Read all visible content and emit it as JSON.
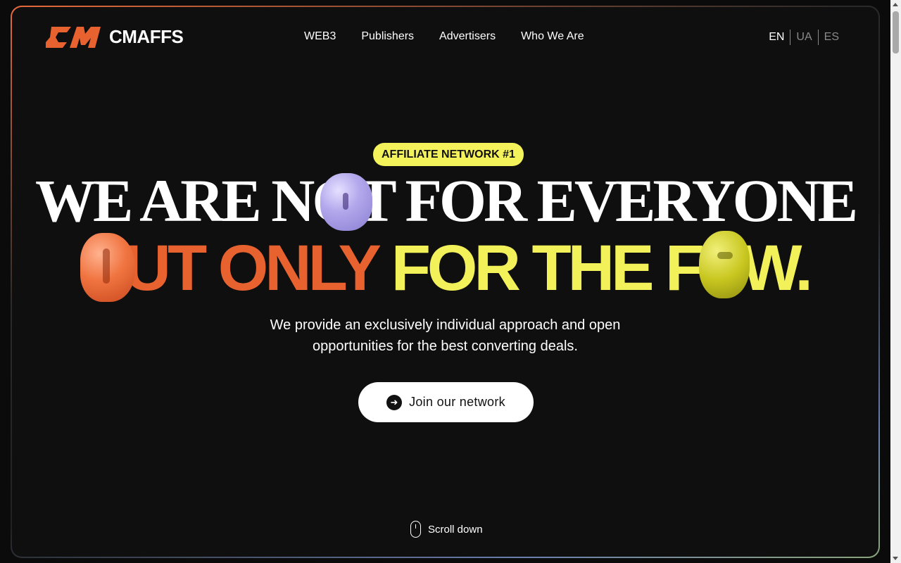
{
  "brand": {
    "name": "CMAFFS",
    "accent": "#e8622f",
    "highlight": "#f3f15a"
  },
  "nav": {
    "items": [
      "WEB3",
      "Publishers",
      "Advertisers",
      "Who We Are"
    ]
  },
  "lang": {
    "items": [
      "EN",
      "UA",
      "ES"
    ],
    "active": "EN"
  },
  "hero": {
    "badge": "AFFILIATE NETWORK #1",
    "line1": "WE ARE NOT FOR EVERYONE",
    "line2_orange": "BUT ONLY",
    "line2_yellow": "FOR THE FEW.",
    "subtext_line1": "We provide an exclusively individual approach and open",
    "subtext_line2": "opportunities for the best converting deals.",
    "cta_label": "Join our network"
  },
  "footer": {
    "scroll_label": "Scroll down"
  }
}
